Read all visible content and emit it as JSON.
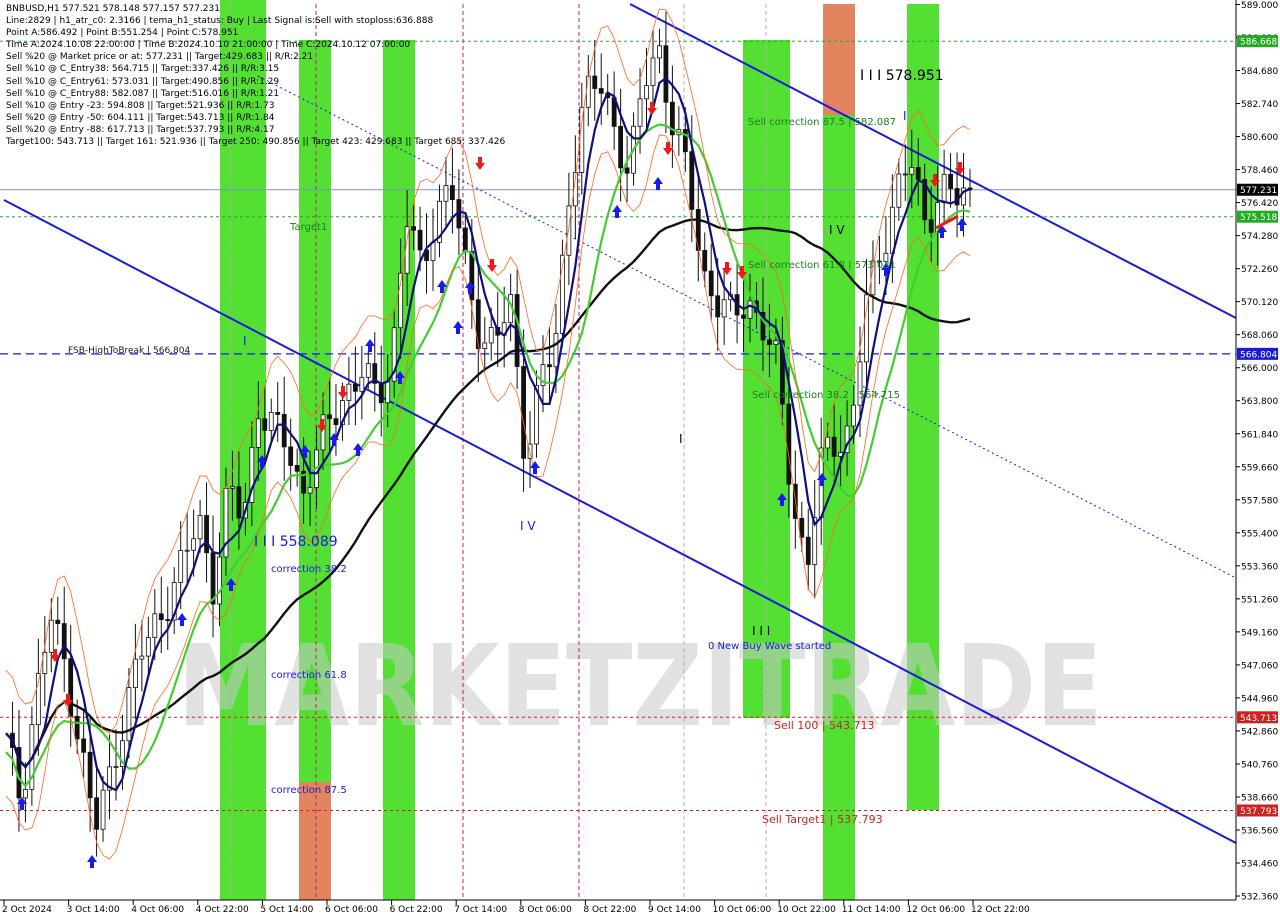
{
  "header": {
    "lines": [
      "BNBUSD,H1  577.521 578.148 577.157 577.231",
      "Line:2829  |  h1_atr_c0: 2.3166  |  tema_h1_status: Buy  |  Last Signal is:Sell with stoploss:636.888",
      "Point A:586.492  |  Point B:551.254  |  Point C:578.951",
      "Time A:2024.10.08 22:00:00  |  Time B:2024.10.10 21:00:00  |  Time C:2024.10.12 07:00:00",
      "Sell %20 @ Market price or at: 577.231  ||  Target:429.683  ||  R/R:2.21",
      "Sell %10 @ C_Entry38: 564.715  ||  Target:337.426  ||  R/R:3.15",
      "Sell %10 @ C_Entry61: 573.031  ||  Target:490.856  ||  R/R:1.29",
      "Sell %10 @ C_Entry88: 582.087  ||  Target:516.016  ||  R/R:1.21",
      "Sell %10 @ Entry -23: 594.808  ||  Target:521.936  ||  R/R:1.73",
      "Sell %20 @ Entry -50: 604.111  ||  Target:543.713  ||  R/R:1.84",
      "Sell %20 @ Entry -88: 617.713  ||  Target:537.793  ||  R/R:4.17",
      "Target100: 543.713  ||  Target 161: 521.936  ||  Target 250: 490.856  ||  Target 423: 429.683  ||  Target 685: 337.426"
    ]
  },
  "watermark": "MARKETZITRADE",
  "chart_data": {
    "type": "candlestick",
    "symbol": "BNBUSD",
    "timeframe": "H1",
    "ohlc_last": {
      "open": 577.521,
      "high": 578.148,
      "low": 577.157,
      "close": 577.231
    },
    "ylim": [
      532.36,
      589.0
    ],
    "x_labels": [
      "2 Oct 2024",
      "3 Oct 14:00",
      "4 Oct 06:00",
      "4 Oct 22:00",
      "5 Oct 14:00",
      "6 Oct 06:00",
      "6 Oct 22:00",
      "7 Oct 14:00",
      "8 Oct 06:00",
      "8 Oct 22:00",
      "9 Oct 14:00",
      "10 Oct 06:00",
      "10 Oct 22:00",
      "11 Oct 14:00",
      "12 Oct 06:00",
      "12 Oct 22:00"
    ],
    "y_ticks": [
      "589.000",
      "586.820",
      "584.680",
      "582.740",
      "580.600",
      "578.460",
      "576.420",
      "574.280",
      "572.260",
      "570.120",
      "568.060",
      "566.000",
      "563.800",
      "561.840",
      "559.660",
      "557.580",
      "555.400",
      "553.360",
      "551.260",
      "549.160",
      "547.060",
      "544.960",
      "542.860",
      "540.760",
      "538.660",
      "536.560",
      "534.460",
      "532.360"
    ],
    "price_tags": [
      {
        "value": "586.668",
        "color": "#22aa22"
      },
      {
        "value": "577.231",
        "color": "#000000"
      },
      {
        "value": "575.518",
        "color": "#22aa22"
      },
      {
        "value": "566.804",
        "color": "#1a1adc"
      },
      {
        "value": "543.713",
        "color": "#cc2222"
      },
      {
        "value": "537.793",
        "color": "#cc2222"
      }
    ],
    "hlines": [
      {
        "price": 586.668,
        "color": "#22aa22",
        "style": "dotted"
      },
      {
        "price": 577.231,
        "color": "#8090c0",
        "style": "solid"
      },
      {
        "price": 575.518,
        "color": "#22aa22",
        "style": "dotted"
      },
      {
        "price": 566.804,
        "color": "#1a1adc",
        "style": "dashed"
      },
      {
        "price": 543.713,
        "color": "#cc2222",
        "style": "dotted"
      },
      {
        "price": 537.793,
        "color": "#cc2222",
        "style": "dotted"
      }
    ],
    "annotations": [
      {
        "text": "I I I 578.951",
        "color": "#000000",
        "size": 14
      },
      {
        "text": "Sell correction 87.5 | 582.087",
        "color": "#1e7d1e",
        "size": 10
      },
      {
        "text": "I",
        "color": "#1a1adc",
        "size": 12
      },
      {
        "text": "Target1",
        "color": "#1e7d1e",
        "size": 10
      },
      {
        "text": "I V",
        "color": "#000000",
        "size": 12
      },
      {
        "text": "Sell correction 61.8 | 573.031",
        "color": "#1e7d1e",
        "size": 10
      },
      {
        "text": "FSB-HighToBreak | 566.804",
        "color": "#1a1a1a",
        "size": 9
      },
      {
        "text": "I",
        "color": "#1a1adc",
        "size": 12
      },
      {
        "text": "Sell correction 38.2 | 564.715",
        "color": "#1e7d1e",
        "size": 10
      },
      {
        "text": "I",
        "color": "#000000",
        "size": 12
      },
      {
        "text": "I V",
        "color": "#1a1adc",
        "size": 12
      },
      {
        "text": "I I I 558.089",
        "color": "#1a1adc",
        "size": 14
      },
      {
        "text": "correction 38.2",
        "color": "#1a1adc",
        "size": 10
      },
      {
        "text": "0 New Buy Wave started",
        "color": "#1a1adc",
        "size": 10
      },
      {
        "text": "I I I",
        "color": "#000000",
        "size": 12
      },
      {
        "text": "correction 61.8",
        "color": "#1a1adc",
        "size": 10
      },
      {
        "text": "Sell 100 | 543.713",
        "color": "#cc2222",
        "size": 11
      },
      {
        "text": "correction 87.5",
        "color": "#1a1adc",
        "size": 10
      },
      {
        "text": "Sell Target1 | 537.793",
        "color": "#cc2222",
        "size": 11
      }
    ],
    "series": [
      {
        "name": "price",
        "values": [
          542.1,
          538.5,
          545.0,
          550.0,
          547.0,
          542.0,
          536.5,
          540.0,
          544.0,
          547.5,
          549.5,
          551.5,
          553.5,
          556.5,
          552.0,
          558.0,
          556.5,
          563.5,
          562.0,
          561.0,
          558.0,
          560.5,
          563.0,
          564.5,
          565.5,
          564.0,
          566.5,
          575.5,
          572.0,
          576.0,
          577.5,
          572.0,
          568.0,
          567.5,
          570.0,
          560.5,
          565.0,
          567.0,
          577.5,
          583.0,
          584.0,
          581.5,
          578.0,
          584.0,
          586.5,
          581.0,
          578.0,
          572.0,
          570.0,
          569.0,
          570.5,
          568.5,
          566.0,
          558.0,
          553.0,
          560.0,
          561.5,
          562.0,
          570.0,
          573.5,
          577.0,
          579.0,
          575.0,
          577.5,
          576.5,
          577.231
        ]
      }
    ]
  }
}
